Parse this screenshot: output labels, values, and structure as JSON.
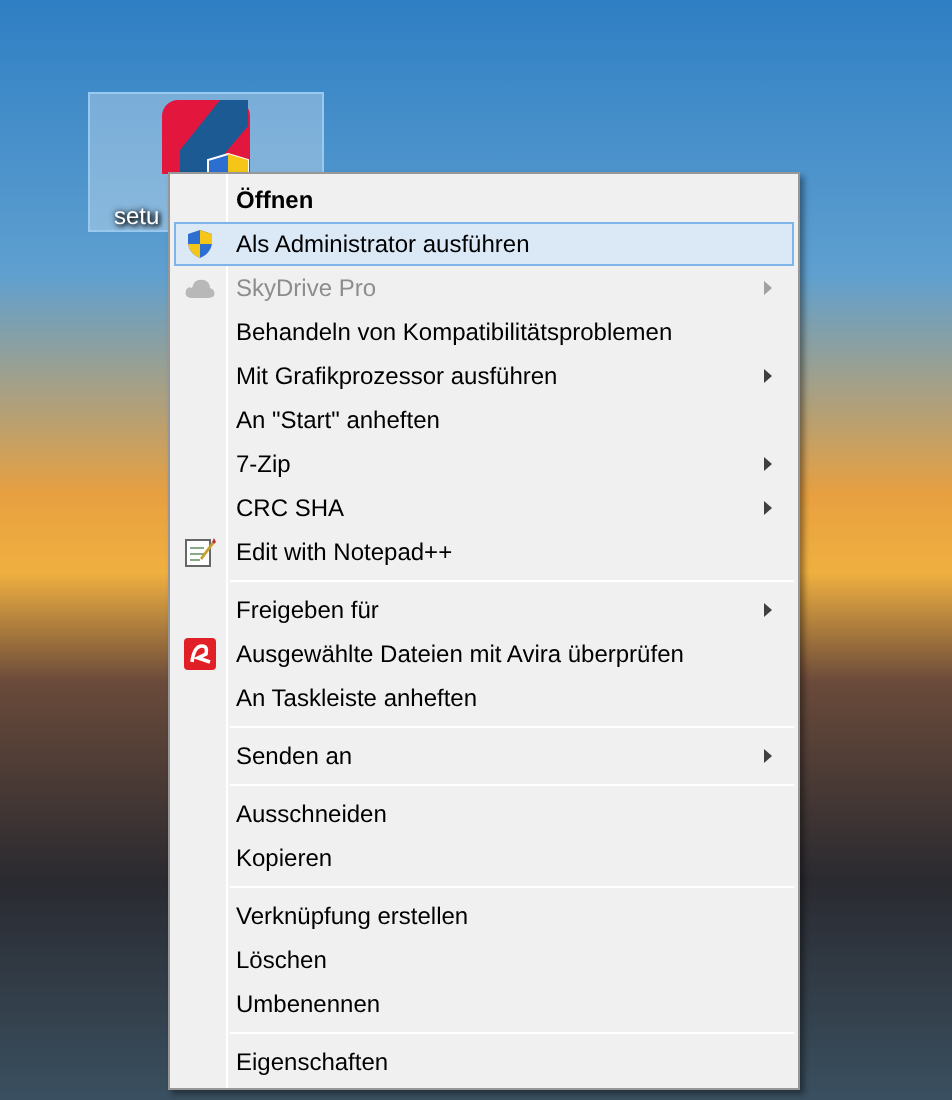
{
  "desktop_icon": {
    "label": "setu",
    "selected": true
  },
  "context_menu": {
    "groups": [
      {
        "items": [
          {
            "label": "Öffnen",
            "default": true,
            "selected": false,
            "disabled": false,
            "submenu": false
          },
          {
            "label": "Als Administrator ausführen",
            "default": false,
            "selected": true,
            "disabled": false,
            "submenu": false
          },
          {
            "label": "SkyDrive Pro",
            "default": false,
            "selected": false,
            "disabled": true,
            "submenu": true
          },
          {
            "label": "Behandeln von Kompatibilitätsproblemen",
            "default": false,
            "selected": false,
            "disabled": false,
            "submenu": false
          },
          {
            "label": "Mit Grafikprozessor ausführen",
            "default": false,
            "selected": false,
            "disabled": false,
            "submenu": true
          },
          {
            "label": "An \"Start\" anheften",
            "default": false,
            "selected": false,
            "disabled": false,
            "submenu": false
          },
          {
            "label": "7-Zip",
            "default": false,
            "selected": false,
            "disabled": false,
            "submenu": true
          },
          {
            "label": "CRC SHA",
            "default": false,
            "selected": false,
            "disabled": false,
            "submenu": true
          },
          {
            "label": "Edit with Notepad++",
            "default": false,
            "selected": false,
            "disabled": false,
            "submenu": false
          }
        ]
      },
      {
        "items": [
          {
            "label": "Freigeben für",
            "default": false,
            "selected": false,
            "disabled": false,
            "submenu": true
          },
          {
            "label": "Ausgewählte Dateien mit Avira überprüfen",
            "default": false,
            "selected": false,
            "disabled": false,
            "submenu": false
          },
          {
            "label": "An Taskleiste anheften",
            "default": false,
            "selected": false,
            "disabled": false,
            "submenu": false
          }
        ]
      },
      {
        "items": [
          {
            "label": "Senden an",
            "default": false,
            "selected": false,
            "disabled": false,
            "submenu": true
          }
        ]
      },
      {
        "items": [
          {
            "label": "Ausschneiden",
            "default": false,
            "selected": false,
            "disabled": false,
            "submenu": false
          },
          {
            "label": "Kopieren",
            "default": false,
            "selected": false,
            "disabled": false,
            "submenu": false
          }
        ]
      },
      {
        "items": [
          {
            "label": "Verknüpfung erstellen",
            "default": false,
            "selected": false,
            "disabled": false,
            "submenu": false
          },
          {
            "label": "Löschen",
            "default": false,
            "selected": false,
            "disabled": false,
            "submenu": false
          },
          {
            "label": "Umbenennen",
            "default": false,
            "selected": false,
            "disabled": false,
            "submenu": false
          }
        ]
      },
      {
        "items": [
          {
            "label": "Eigenschaften",
            "default": false,
            "selected": false,
            "disabled": false,
            "submenu": false
          }
        ]
      }
    ]
  }
}
